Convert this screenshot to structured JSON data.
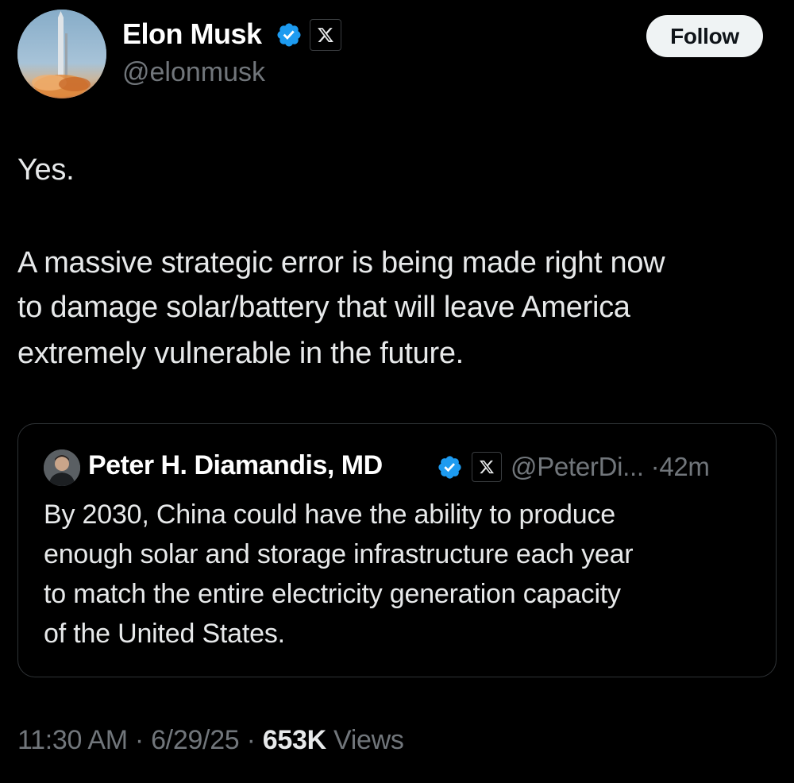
{
  "tweet": {
    "author": {
      "name": "Elon Musk",
      "handle": "@elonmusk",
      "verified": true,
      "badge_icon": "x-logo-icon",
      "avatar_icon": "rocket-launch-avatar"
    },
    "follow_label": "Follow",
    "lines": [
      "Yes.",
      "A massive strategic error is being made right now",
      "to damage solar/battery that will leave America",
      "extremely vulnerable in the future."
    ],
    "timestamp": {
      "time": "11:30 AM",
      "date": "6/29/25",
      "separator": "·",
      "views_count": "653K",
      "views_label": "Views"
    }
  },
  "quoted": {
    "author": {
      "name": "Peter H. Diamandis, MD",
      "handle": "@PeterDi...",
      "verified": true,
      "badge_icon": "x-logo-icon",
      "avatar_icon": "person-portrait-avatar"
    },
    "age": "42m",
    "separator": "·",
    "lines": [
      "By 2030, China could have the ability to produce",
      "enough solar and storage infrastructure each year",
      "to match the entire electricity generation capacity",
      "of the United States."
    ]
  },
  "colors": {
    "background": "#000000",
    "text_primary": "#e7e9ea",
    "text_secondary": "#71767b",
    "verified_blue": "#1d9bf0",
    "card_border": "#2f3336",
    "follow_bg": "#eff3f4"
  }
}
